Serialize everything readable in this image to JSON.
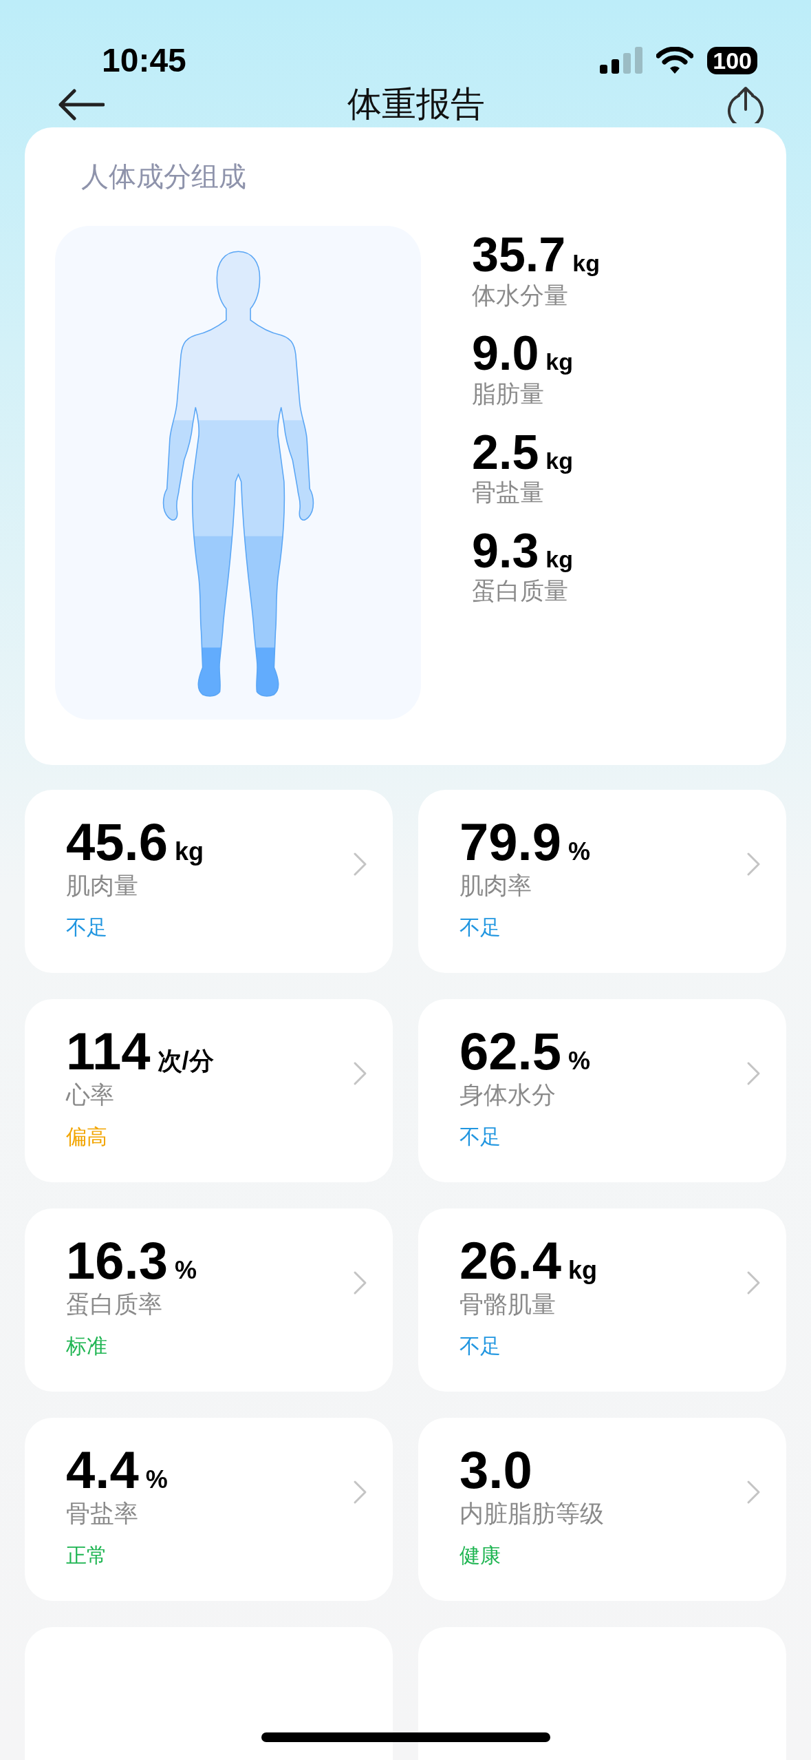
{
  "status_bar": {
    "time": "10:45",
    "battery": "100"
  },
  "header": {
    "title": "体重报告"
  },
  "composition": {
    "title": "人体成分组成",
    "items": [
      {
        "value": "35.7",
        "unit": "kg",
        "label": "体水分量"
      },
      {
        "value": "9.0",
        "unit": "kg",
        "label": "脂肪量"
      },
      {
        "value": "2.5",
        "unit": "kg",
        "label": "骨盐量"
      },
      {
        "value": "9.3",
        "unit": "kg",
        "label": "蛋白质量"
      }
    ]
  },
  "metrics": [
    {
      "value": "45.6",
      "unit": "kg",
      "label": "肌肉量",
      "status": "不足",
      "color": "#2196e0"
    },
    {
      "value": "79.9",
      "unit": "%",
      "label": "肌肉率",
      "status": "不足",
      "color": "#2196e0"
    },
    {
      "value": "114",
      "unit": "次/分",
      "label": "心率",
      "status": "偏高",
      "color": "#f2a500"
    },
    {
      "value": "62.5",
      "unit": "%",
      "label": "身体水分",
      "status": "不足",
      "color": "#2196e0"
    },
    {
      "value": "16.3",
      "unit": "%",
      "label": "蛋白质率",
      "status": "标准",
      "color": "#1fb552"
    },
    {
      "value": "26.4",
      "unit": "kg",
      "label": "骨骼肌量",
      "status": "不足",
      "color": "#2196e0"
    },
    {
      "value": "4.4",
      "unit": "%",
      "label": "骨盐率",
      "status": "正常",
      "color": "#1fb552"
    },
    {
      "value": "3.0",
      "label": "内脏脂肪等级",
      "status": "健康",
      "color": "#1fb552"
    }
  ]
}
